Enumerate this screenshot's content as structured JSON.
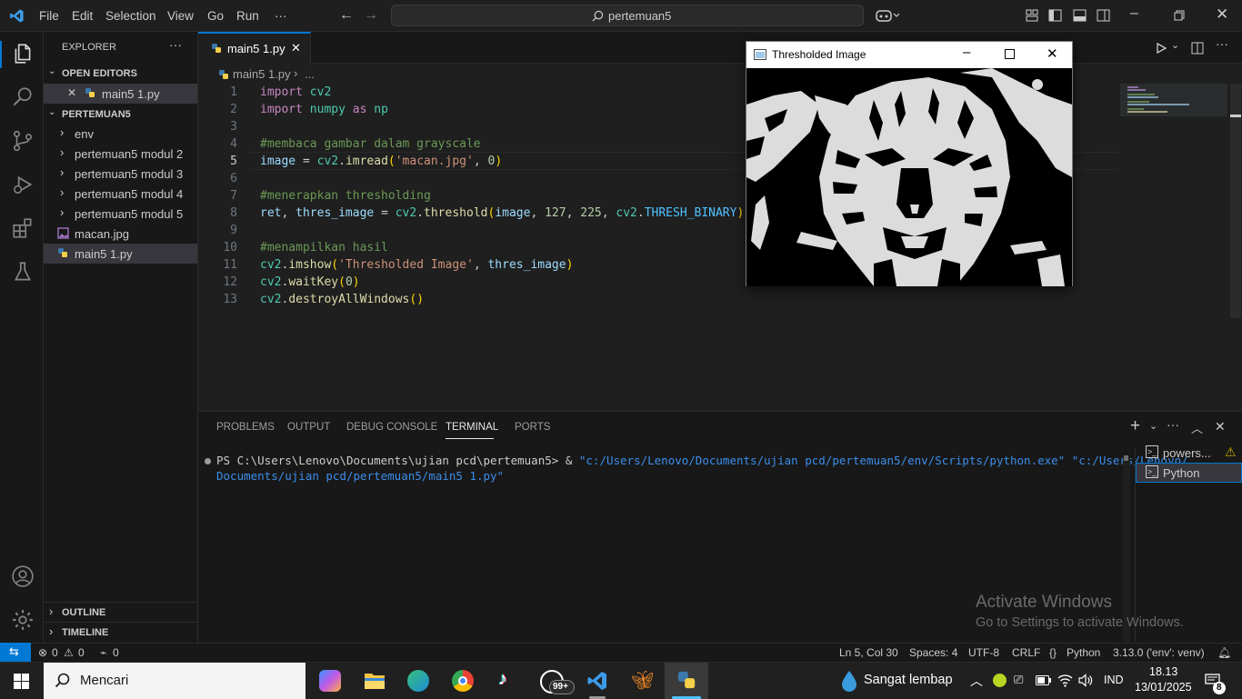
{
  "menu": [
    "File",
    "Edit",
    "Selection",
    "View",
    "Go",
    "Run",
    "···"
  ],
  "command_center": "pertemuan5",
  "sidebar": {
    "title": "EXPLORER",
    "open_editors_label": "OPEN EDITORS",
    "open_editor_file": "main5 1.py",
    "folder_label": "PERTEMUAN5",
    "items": [
      {
        "label": "env",
        "type": "folder"
      },
      {
        "label": "pertemuan5 modul 2",
        "type": "folder"
      },
      {
        "label": "pertemuan5 modul 3",
        "type": "folder"
      },
      {
        "label": "pertemuan5 modul 4",
        "type": "folder"
      },
      {
        "label": "pertemuan5 modul 5",
        "type": "folder"
      },
      {
        "label": "macan.jpg",
        "type": "image"
      },
      {
        "label": "main5 1.py",
        "type": "python"
      }
    ],
    "outline_label": "OUTLINE",
    "timeline_label": "TIMELINE"
  },
  "editor": {
    "tab_label": "main5 1.py",
    "breadcrumb_file": "main5 1.py",
    "breadcrumb_more": "...",
    "line_numbers": [
      "1",
      "2",
      "3",
      "4",
      "5",
      "6",
      "7",
      "8",
      "9",
      "10",
      "11",
      "12",
      "13"
    ],
    "lines": [
      "import cv2",
      "import numpy as np",
      "",
      "#membaca gambar dalam grayscale",
      "image = cv2.imread('macan.jpg', 0)",
      "",
      "#menerapkan thresholding",
      "ret, thres_image = cv2.threshold(image, 127, 225, cv2.THRESH_BINARY)",
      "",
      "#menampilkan hasil",
      "cv2.imshow('Thresholded Image', thres_image)",
      "cv2.waitKey(0)",
      "cv2.destroyAllWindows()"
    ],
    "current_line": "5"
  },
  "panel": {
    "tabs": [
      "PROBLEMS",
      "OUTPUT",
      "DEBUG CONSOLE",
      "TERMINAL",
      "PORTS"
    ],
    "active_tab": "TERMINAL",
    "terminal_prompt": "PS C:\\Users\\Lenovo\\Documents\\ujian pcd\\pertemuan5> ",
    "terminal_amp": "& ",
    "terminal_cmd1": "\"c:/Users/Lenovo/Documents/ujian pcd/pertemuan5/env/Scripts/python.exe\" \"c:/Users/Lenovo/",
    "terminal_cmd2": "Documents/ujian pcd/pertemuan5/main5 1.py\"",
    "terminals": [
      "powers...",
      "Python"
    ]
  },
  "watermark": {
    "title": "Activate Windows",
    "subtitle": "Go to Settings to activate Windows."
  },
  "statusbar": {
    "errors": "0",
    "warnings": "0",
    "ports": "0",
    "position": "Ln 5, Col 30",
    "spaces": "Spaces: 4",
    "encoding": "UTF-8",
    "eol": "CRLF",
    "language": "Python",
    "interpreter": "3.13.0 ('env': venv)"
  },
  "cv_window": {
    "title": "Thresholded Image"
  },
  "taskbar": {
    "search_placeholder": "Mencari",
    "weather": "Sangat lembap",
    "language": "IND",
    "time": "18.13",
    "date": "13/01/2025",
    "notifications": "8",
    "whatsapp_badge": "99+"
  }
}
